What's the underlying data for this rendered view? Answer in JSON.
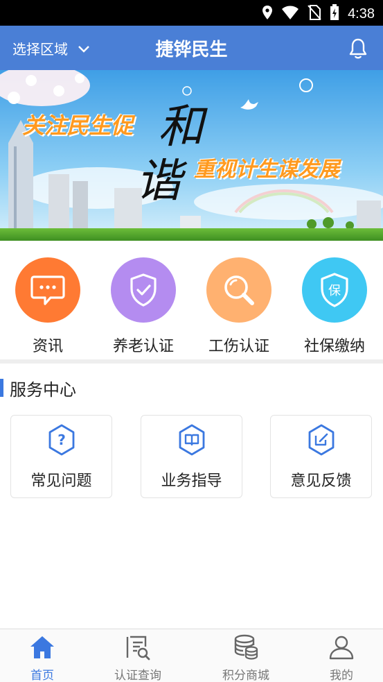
{
  "status_bar": {
    "time": "4:38"
  },
  "header": {
    "region_label": "选择区域",
    "title": "捷铧民生"
  },
  "banner": {
    "headline_left": "关注民生促",
    "calligraphy_1": "和",
    "calligraphy_2": "谐",
    "headline_right": "重视计生谋发展"
  },
  "quick_actions": [
    {
      "label": "资讯",
      "color": "#ff7a33",
      "icon": "message-icon"
    },
    {
      "label": "养老认证",
      "color": "#b48cf0",
      "icon": "shield-check-icon"
    },
    {
      "label": "工伤认证",
      "color": "#ffb170",
      "icon": "magnifier-icon"
    },
    {
      "label": "社保缴纳",
      "color": "#3fc8f3",
      "icon": "insurance-shield-icon"
    }
  ],
  "service_center": {
    "title": "服务中心",
    "items": [
      {
        "label": "常见问题",
        "icon": "question-icon"
      },
      {
        "label": "业务指导",
        "icon": "guide-book-icon"
      },
      {
        "label": "意见反馈",
        "icon": "feedback-edit-icon"
      }
    ]
  },
  "bottom_nav": [
    {
      "label": "首页",
      "icon": "home-icon",
      "active": true
    },
    {
      "label": "认证查询",
      "icon": "query-document-icon",
      "active": false
    },
    {
      "label": "积分商城",
      "icon": "coins-icon",
      "active": false
    },
    {
      "label": "我的",
      "icon": "user-icon",
      "active": false
    }
  ],
  "colors": {
    "header": "#4a7fd6",
    "accent": "#3b78e0"
  }
}
